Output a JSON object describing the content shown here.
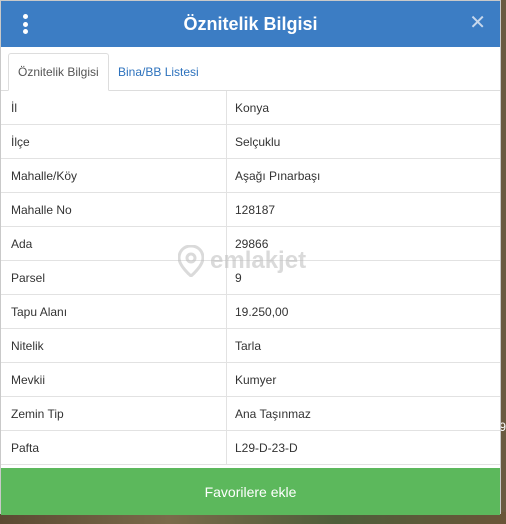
{
  "dialog": {
    "title": "Öznitelik Bilgisi",
    "close_symbol": "✕"
  },
  "tabs": [
    {
      "label": "Öznitelik Bilgisi",
      "active": true
    },
    {
      "label": "Bina/BB Listesi",
      "active": false
    }
  ],
  "rows": [
    {
      "label": "İl",
      "value": "Konya"
    },
    {
      "label": "İlçe",
      "value": "Selçuklu"
    },
    {
      "label": "Mahalle/Köy",
      "value": "Aşağı Pınarbaşı"
    },
    {
      "label": "Mahalle No",
      "value": "128187"
    },
    {
      "label": "Ada",
      "value": "29866"
    },
    {
      "label": "Parsel",
      "value": "9"
    },
    {
      "label": "Tapu Alanı",
      "value": "19.250,00"
    },
    {
      "label": "Nitelik",
      "value": "Tarla"
    },
    {
      "label": "Mevkii",
      "value": "Kumyer"
    },
    {
      "label": "Zemin Tip",
      "value": "Ana Taşınmaz"
    },
    {
      "label": "Pafta",
      "value": "L29-D-23-D"
    }
  ],
  "watermark": "emlakjet",
  "action": {
    "favorite_label": "Favorilere ekle"
  },
  "background_edge_text": "9",
  "colors": {
    "header": "#3c7dc4",
    "button": "#5cb85c",
    "tab_link": "#2d72bd"
  },
  "icons": {
    "menu": "vertical-dots-icon",
    "close": "close-icon",
    "watermark": "location-pin-icon"
  }
}
